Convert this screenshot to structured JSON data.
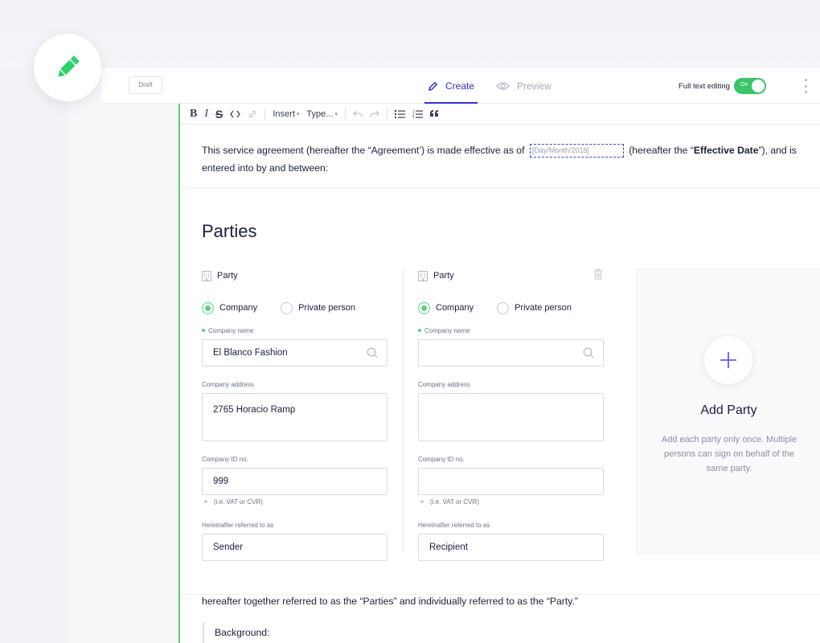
{
  "topbar": {
    "draft_label": "Draft",
    "tabs": [
      {
        "label": "Create",
        "active": true
      },
      {
        "label": "Preview",
        "active": false
      }
    ],
    "full_text_label": "Full text editing",
    "toggle_label": "On"
  },
  "toolbar": {
    "insert_label": "Insert",
    "type_label": "Type..."
  },
  "doc": {
    "intro_part1": "This service agreement (hereafter the “Agreement’) is made effective as of",
    "date_placeholder": "[Day/Month/2018]",
    "intro_part2": "(hereafter the “",
    "intro_bold": "Effective Date",
    "intro_part3": "”), and is entered into by and between:",
    "parties_title": "Parties",
    "together_text": "hereafter together referred to as the “Parties” and individually referred to as the “Party.”",
    "background_label": "Background:"
  },
  "parties": [
    {
      "header": "Party",
      "radio_company": "Company",
      "radio_private": "Private person",
      "company_name_label": "Company name",
      "company_name": "El Blanco Fashion",
      "address_label": "Company address",
      "address": "2765 Horacio Ramp",
      "id_label": "Company ID no.",
      "id_value": "999",
      "id_hint": "(i.e. VAT or CVR)",
      "referred_label": "Hereinafter referred to as",
      "referred_value": "Sender"
    },
    {
      "header": "Party",
      "radio_company": "Company",
      "radio_private": "Private person",
      "company_name_label": "Company name",
      "company_name": "",
      "address_label": "Company address",
      "address": "",
      "id_label": "Company ID no.",
      "id_value": "",
      "id_hint": "(i.e. VAT or CVR)",
      "referred_label": "Hereinafter referred to as",
      "referred_value": "Recipient"
    }
  ],
  "add_party": {
    "title": "Add Party",
    "description": "Add each party only once. Multiple persons can sign on behalf of the same party."
  },
  "colors": {
    "accent": "#2f33c7",
    "green": "#39c46a",
    "plus": "#6b5ce7"
  }
}
